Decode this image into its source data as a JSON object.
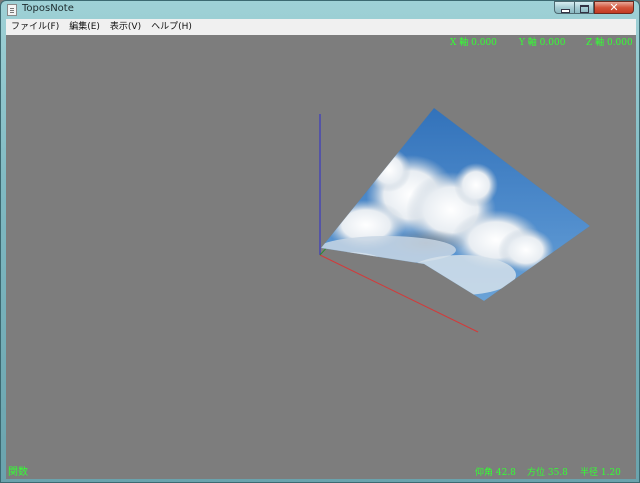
{
  "window": {
    "title": "ToposNote",
    "close_glyph": "✕"
  },
  "menubar": {
    "items": [
      "ファイル(F)",
      "編集(E)",
      "表示(V)",
      "ヘルプ(H)"
    ]
  },
  "viewport": {
    "axis_readout": {
      "x": "X 軸  0.000",
      "y": "Y 軸  0.000",
      "z": "Z 軸  0.000"
    },
    "mode_label": "関数",
    "camera_readout": {
      "elevation": "仰角 42.8",
      "azimuth": "方位 35.8",
      "radius": "半径  1.20"
    },
    "texture": "sky-cloud-photo",
    "colors": {
      "background": "#7d7d7d",
      "hud_text": "#33ff33",
      "x_axis": "#d33a3a",
      "y_axis": "#2e8b2e",
      "z_axis": "#2a2ad0"
    }
  }
}
